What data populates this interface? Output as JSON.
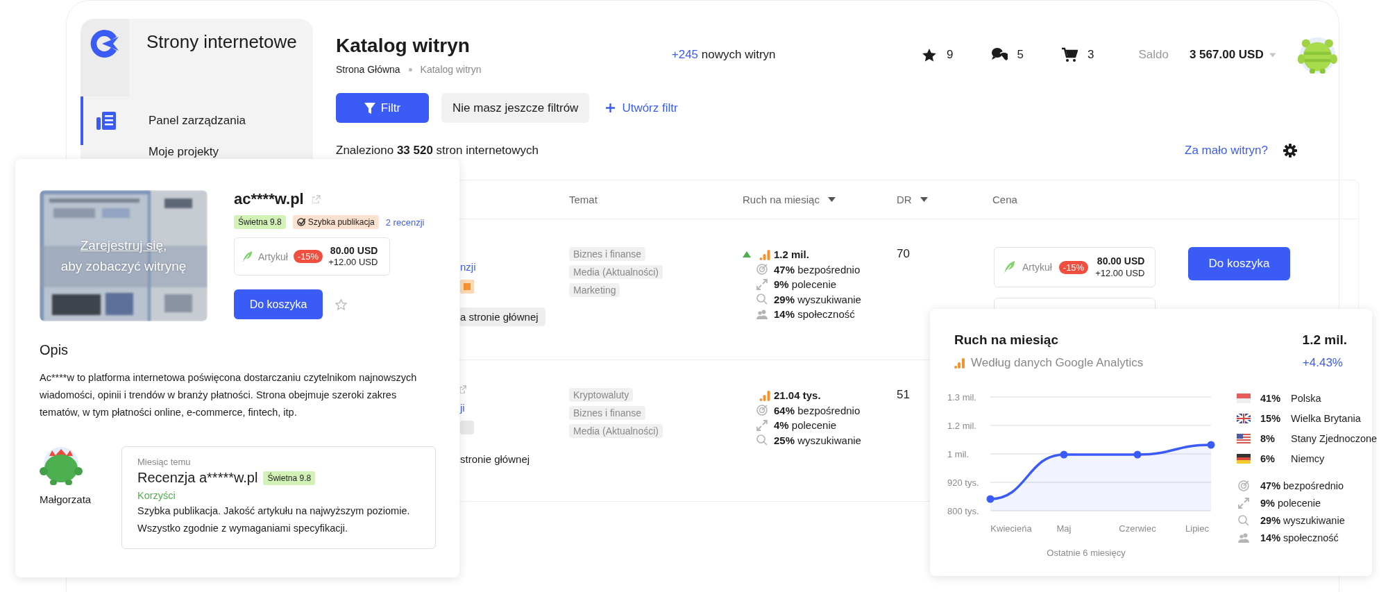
{
  "sidebar": {
    "title": "Strony internetowe",
    "items": [
      {
        "label": "Panel zarządzania",
        "selected": true
      },
      {
        "label": "Moje projekty",
        "selected": false
      }
    ]
  },
  "header": {
    "title": "Katalog witryn",
    "breadcrumbs": [
      "Strona Główna",
      "Katalog witryn"
    ],
    "new_count": "+245",
    "new_label": "nowych witryn",
    "counters": [
      {
        "kind": "favorites",
        "count": "9"
      },
      {
        "kind": "messages",
        "count": "5"
      },
      {
        "kind": "cart",
        "count": "3"
      }
    ],
    "balance_label": "Saldo",
    "balance": "3 567.00 USD"
  },
  "filters": {
    "filter_button": "Filtr",
    "saved": "Nie masz jeszcze filtrów",
    "create": "Utwórz filtr"
  },
  "results": {
    "summary": "Znaleziono **33 520** stron internetowych",
    "too_few_link": "Za mało witryn?"
  },
  "table": {
    "columns": [
      {
        "label": "Temat",
        "sortable": false
      },
      {
        "label": "Ruch na miesiąc",
        "sortable": true
      },
      {
        "label": "DR",
        "sortable": true
      },
      {
        "label": "Cena",
        "sortable": false
      }
    ],
    "rows": [
      {
        "external_link": false,
        "reviews": "nzji",
        "chat_badge": true,
        "tag": "a stronie głównej",
        "tag_chip": true,
        "topics": [
          "Biznes i finanse",
          "Media (Aktualności)",
          "Marketing"
        ],
        "rising": true,
        "total": "1.2 mil.",
        "sources": [
          {
            "kind": "direct",
            "percent": "47%",
            "label": "bezpośrednio"
          },
          {
            "kind": "referral",
            "percent": "9%",
            "label": "polecenie"
          },
          {
            "kind": "search",
            "percent": "29%",
            "label": "wyszukiwanie"
          },
          {
            "kind": "social",
            "percent": "14%",
            "label": "społeczność"
          }
        ],
        "dr": "70",
        "price": {
          "type": "Artykuł",
          "discount": "-15%",
          "amount": "80.00 USD",
          "extra": "+12.00 USD"
        },
        "button": "Do koszyka"
      },
      {
        "external_link": true,
        "reviews": "ji",
        "chat_badge": false,
        "tag": "stronie głównej",
        "tag_chip": false,
        "topics": [
          "Kryptowaluty",
          "Biznes i finanse",
          "Media (Aktualności)"
        ],
        "rising": false,
        "total": "21.04 tys.",
        "sources": [
          {
            "kind": "direct",
            "percent": "64%",
            "label": "bezpośrednio"
          },
          {
            "kind": "referral",
            "percent": "4%",
            "label": "polecenie"
          },
          {
            "kind": "search",
            "percent": "25%",
            "label": "wyszukiwanie"
          }
        ],
        "dr": "51"
      }
    ]
  },
  "site_card": {
    "register_link": "Zarejestruj się,",
    "register_caption": "aby zobaczyć witrynę",
    "domain": "ac****w.pl",
    "rating": "Świetna 9.8",
    "fast_tag": "Szybka publikacja",
    "reviews": "2 recenzji",
    "price": {
      "type": "Artykuł",
      "discount": "-15%",
      "amount": "80.00 USD",
      "extra": "+12.00 USD"
    },
    "button": "Do koszyka",
    "favorite": false,
    "description_title": "Opis",
    "description": "Ac****w to platforma internetowa poświęcona dostarczaniu czytelnikom najnowszych wiadomości, opinii i trendów w branży płatności. Strona obejmuje szeroki zakres tematów, w tym płatności online, e-commerce, fintech, itp.",
    "review": {
      "author": "Małgorzata",
      "time": "Miesiąc temu",
      "title": "Recenzja a*****w.pl",
      "rating": "Świetna 9.8",
      "section": "Korzyści",
      "text": "Szybka publikacja. Jakość artykułu na najwyższym poziomie. Wszystko zgodnie z wymaganiami specyfikacji."
    }
  },
  "traffic_card": {
    "title": "Ruch na miesiąc",
    "total": "1.2 mil.",
    "source": "Według danych Google Analytics",
    "change": "+4.43%",
    "chart": {
      "y_labels": [
        "1.3 mil.",
        "1.2 mil.",
        "1 mil.",
        "920 tys.",
        "800 tys."
      ],
      "x_labels": [
        "Kwiecieńa",
        "Maj",
        "Czerwiec",
        "Lipiec"
      ],
      "caption": "Ostatnie 6 miesięcy"
    },
    "countries": [
      {
        "kind": "pl",
        "percent": "41%",
        "name": "Polska"
      },
      {
        "kind": "gb",
        "percent": "15%",
        "name": "Wielka Brytania"
      },
      {
        "kind": "us",
        "percent": "8%",
        "name": "Stany Zjednoczone"
      },
      {
        "kind": "de",
        "percent": "6%",
        "name": "Niemcy"
      }
    ],
    "sources": [
      {
        "kind": "direct",
        "percent": "47%",
        "label": "bezpośrednio"
      },
      {
        "kind": "referral",
        "percent": "9%",
        "label": "polecenie"
      },
      {
        "kind": "search",
        "percent": "29%",
        "label": "wyszukiwanie"
      },
      {
        "kind": "social",
        "percent": "14%",
        "label": "społeczność"
      }
    ]
  }
}
